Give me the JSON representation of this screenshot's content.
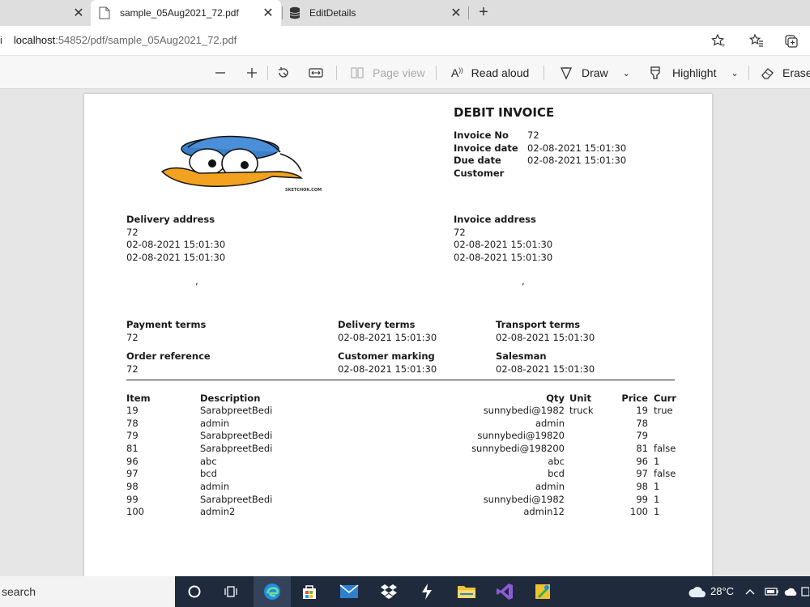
{
  "browser": {
    "tabs": [
      {
        "title": "sample_05Aug2021_72.pdf",
        "active": true
      },
      {
        "title": "EditDetails",
        "active": false
      }
    ],
    "url_host": "localhost",
    "url_rest": ":54852/pdf/sample_05Aug2021_72.pdf"
  },
  "pdf_toolbar": {
    "page_view": "Page view",
    "read_aloud": "Read aloud",
    "draw": "Draw",
    "highlight": "Highlight",
    "erase": "Erase"
  },
  "invoice": {
    "title": "DEBIT INVOICE",
    "logo_watermark": "SKETCHOK.COM",
    "meta": [
      {
        "label": "Invoice No",
        "value": "72"
      },
      {
        "label": "Invoice date",
        "value": "02-08-2021 15:01:30"
      },
      {
        "label": "Due date",
        "value": "02-08-2021 15:01:30"
      },
      {
        "label": "Customer",
        "value": ""
      }
    ],
    "delivery_address": {
      "label": "Delivery address",
      "lines": [
        "72",
        "02-08-2021 15:01:30",
        "02-08-2021 15:01:30"
      ],
      "extra": ","
    },
    "invoice_address": {
      "label": "Invoice address",
      "lines": [
        "72",
        "02-08-2021 15:01:30",
        "02-08-2021 15:01:30"
      ],
      "extra": ","
    },
    "terms": [
      {
        "label": "Payment terms",
        "value": "72"
      },
      {
        "label": "Delivery terms",
        "value": "02-08-2021 15:01:30"
      },
      {
        "label": "Transport terms",
        "value": "02-08-2021 15:01:30"
      },
      {
        "label": "Order reference",
        "value": "72"
      },
      {
        "label": "Customer marking",
        "value": "02-08-2021 15:01:30"
      },
      {
        "label": "Salesman",
        "value": "02-08-2021 15:01:30"
      }
    ],
    "table_headers": {
      "item": "Item",
      "description": "Description",
      "qty": "Qty",
      "unit": "Unit",
      "price": "Price",
      "curr": "Curr"
    },
    "rows": [
      {
        "item": "19",
        "description": "SarabpreetBedi",
        "qty": "sunnybedi@1982",
        "unit": "truck",
        "price": "19",
        "curr": "true"
      },
      {
        "item": "78",
        "description": "admin",
        "qty": "admin",
        "unit": "",
        "price": "78",
        "curr": ""
      },
      {
        "item": "79",
        "description": "SarabpreetBedi",
        "qty": "sunnybedi@19820",
        "unit": "",
        "price": "79",
        "curr": ""
      },
      {
        "item": "81",
        "description": "SarabpreetBedi",
        "qty": "sunnybedi@198200",
        "unit": "",
        "price": "81",
        "curr": "false"
      },
      {
        "item": "96",
        "description": "abc",
        "qty": "abc",
        "unit": "",
        "price": "96",
        "curr": "1"
      },
      {
        "item": "97",
        "description": "bcd",
        "qty": "bcd",
        "unit": "",
        "price": "97",
        "curr": "false"
      },
      {
        "item": "98",
        "description": "admin",
        "qty": "admin",
        "unit": "",
        "price": "98",
        "curr": "1"
      },
      {
        "item": "99",
        "description": "SarabpreetBedi",
        "qty": "sunnybedi@1982",
        "unit": "",
        "price": "99",
        "curr": "1"
      },
      {
        "item": "100",
        "description": "admin2",
        "qty": "admin12",
        "unit": "",
        "price": "100",
        "curr": "1"
      }
    ]
  },
  "taskbar": {
    "search_placeholder": "search",
    "temperature": "28°C",
    "accent": "#1f2a3c"
  }
}
